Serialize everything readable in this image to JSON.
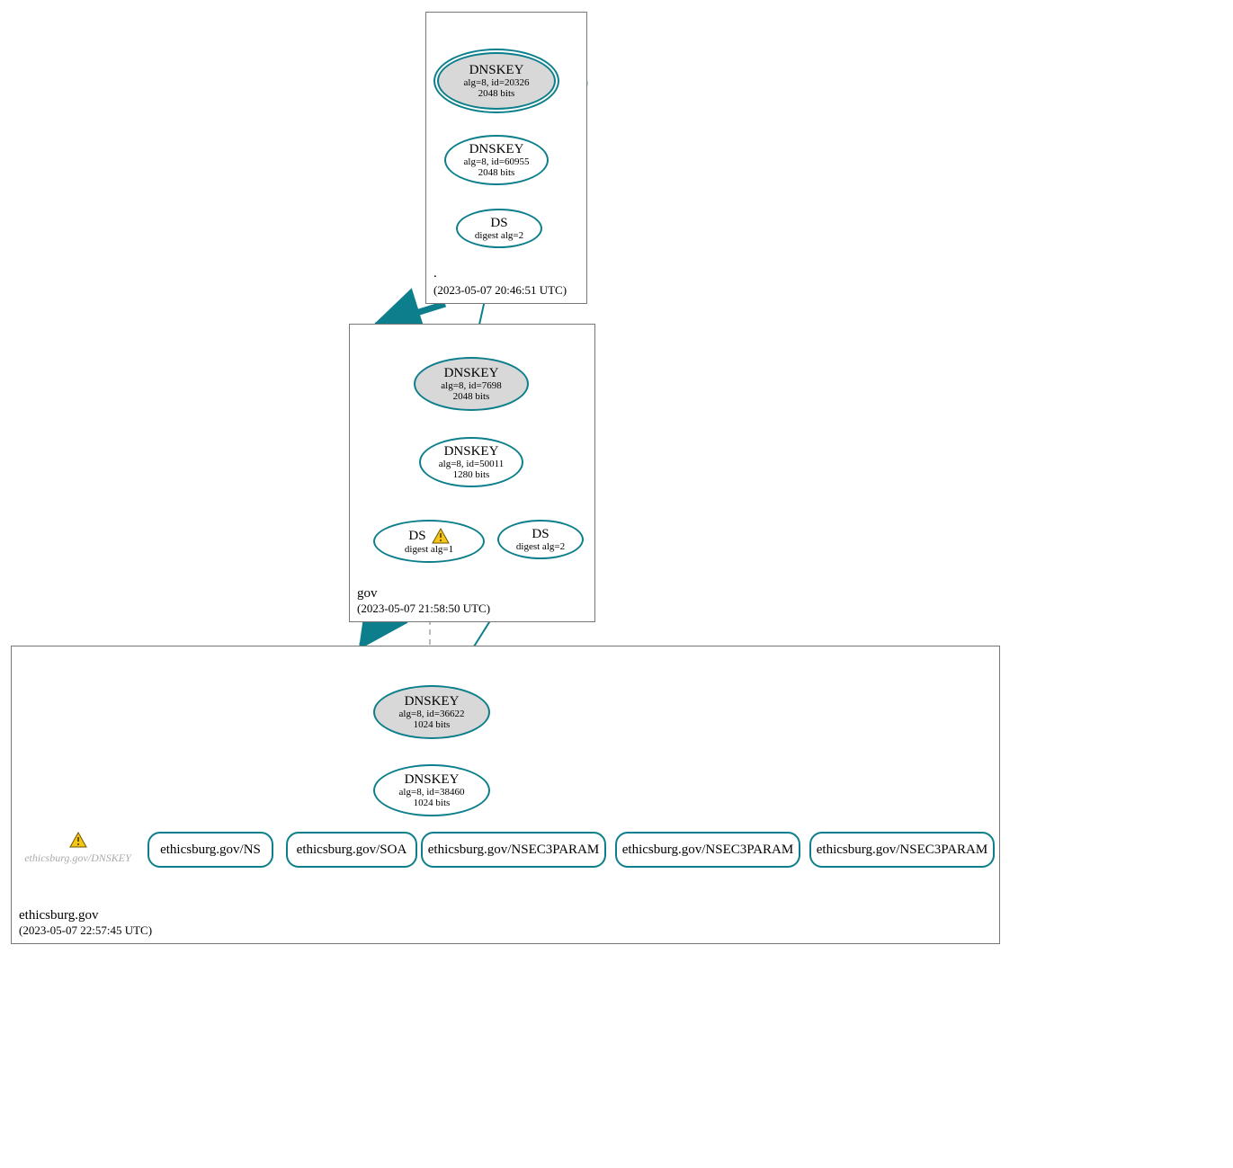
{
  "zones": {
    "root": {
      "label": ".",
      "timestamp": "(2023-05-07 20:46:51 UTC)",
      "nodes": {
        "ksk": {
          "title": "DNSKEY",
          "sub1": "alg=8, id=20326",
          "sub2": "2048 bits"
        },
        "zsk": {
          "title": "DNSKEY",
          "sub1": "alg=8, id=60955",
          "sub2": "2048 bits"
        },
        "ds": {
          "title": "DS",
          "sub1": "digest alg=2"
        }
      }
    },
    "gov": {
      "label": "gov",
      "timestamp": "(2023-05-07 21:58:50 UTC)",
      "nodes": {
        "ksk": {
          "title": "DNSKEY",
          "sub1": "alg=8, id=7698",
          "sub2": "2048 bits"
        },
        "zsk": {
          "title": "DNSKEY",
          "sub1": "alg=8, id=50011",
          "sub2": "1280 bits"
        },
        "ds1": {
          "title": "DS",
          "sub1": "digest alg=1"
        },
        "ds2": {
          "title": "DS",
          "sub1": "digest alg=2"
        }
      }
    },
    "leaf": {
      "label": "ethicsburg.gov",
      "timestamp": "(2023-05-07 22:57:45 UTC)",
      "nodes": {
        "ksk": {
          "title": "DNSKEY",
          "sub1": "alg=8, id=36622",
          "sub2": "1024 bits"
        },
        "zsk": {
          "title": "DNSKEY",
          "sub1": "alg=8, id=38460",
          "sub2": "1024 bits"
        }
      },
      "rrsets": {
        "ns": "ethicsburg.gov/NS",
        "soa": "ethicsburg.gov/SOA",
        "n1": "ethicsburg.gov/NSEC3PARAM",
        "n2": "ethicsburg.gov/NSEC3PARAM",
        "n3": "ethicsburg.gov/NSEC3PARAM"
      },
      "ghost": "ethicsburg.gov/DNSKEY"
    }
  }
}
